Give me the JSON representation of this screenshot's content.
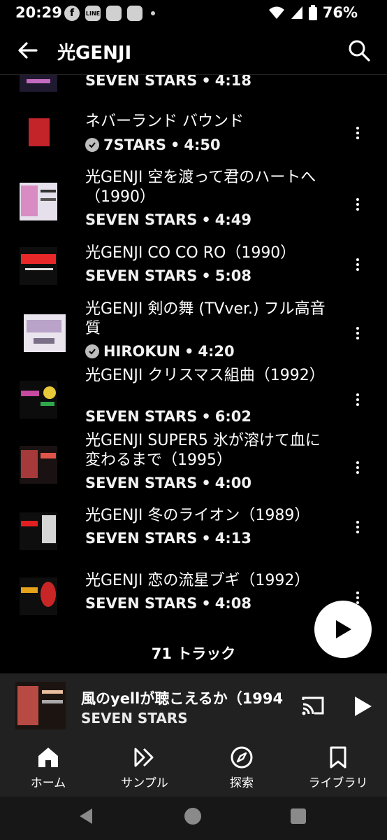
{
  "status_bar": {
    "time": "20:29",
    "battery": "76%",
    "icons": [
      "facebook-icon",
      "line-icon",
      "app-icon",
      "app-icon"
    ]
  },
  "app_bar": {
    "title": "光GENJI"
  },
  "tracks": [
    {
      "title": "",
      "artist": "SEVEN STARS",
      "duration": "4:18",
      "verified": false
    },
    {
      "title": "ネバーランド バウンド",
      "artist": "7STARS",
      "duration": "4:50",
      "verified": true
    },
    {
      "title": "光GENJI  空を渡って君のハートへ（1990）",
      "artist": "SEVEN STARS",
      "duration": "4:49",
      "verified": false
    },
    {
      "title": "光GENJI  CO CO RO（1990）",
      "artist": "SEVEN STARS",
      "duration": "5:08",
      "verified": false
    },
    {
      "title": "光GENJI 剣の舞 (TVver.) フル高音質",
      "artist": "HIROKUN",
      "duration": "4:20",
      "verified": true
    },
    {
      "title": "光GENJI  クリスマス組曲（1992）",
      "artist": "SEVEN STARS",
      "duration": "6:02",
      "verified": false
    },
    {
      "title": "光GENJI SUPER5  氷が溶けて血に変わるまで（1995）",
      "artist": "SEVEN STARS",
      "duration": "4:00",
      "verified": false
    },
    {
      "title": "光GENJI  冬のライオン（1989）",
      "artist": "SEVEN STARS",
      "duration": "4:13",
      "verified": false
    },
    {
      "title": "光GENJI  恋の流星ブギ（1992）",
      "artist": "SEVEN STARS",
      "duration": "4:08",
      "verified": false
    }
  ],
  "separator": " • ",
  "track_count": "71 トラック",
  "mini_player": {
    "title": "風のyellが聴こえるか（1994",
    "artist": "SEVEN STARS"
  },
  "bottom_nav": [
    {
      "label": "ホーム",
      "icon": "home-icon",
      "active": true
    },
    {
      "label": "サンプル",
      "icon": "samples-icon",
      "active": false
    },
    {
      "label": "探索",
      "icon": "explore-icon",
      "active": false
    },
    {
      "label": "ライブラリ",
      "icon": "library-icon",
      "active": false
    }
  ],
  "colors": {
    "background": "#000000",
    "surface": "#212121",
    "text": "#ffffff"
  }
}
